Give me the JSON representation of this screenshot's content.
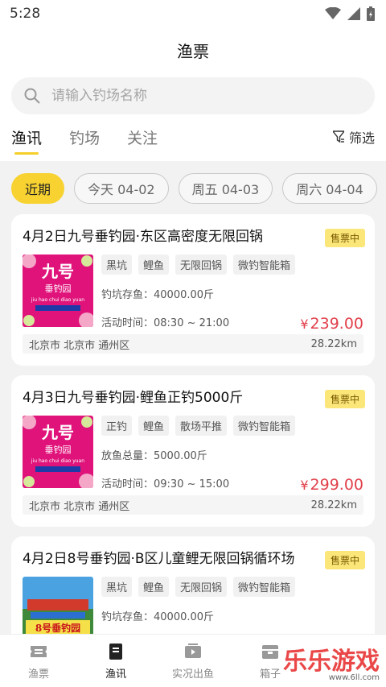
{
  "status": {
    "time": "5:28"
  },
  "header": {
    "title": "渔票"
  },
  "search": {
    "placeholder": "请输入钓场名称"
  },
  "tabs": [
    {
      "label": "渔讯"
    },
    {
      "label": "钓场"
    },
    {
      "label": "关注"
    }
  ],
  "filter": {
    "label": "筛选"
  },
  "dates": [
    {
      "label": "近期"
    },
    {
      "label": "今天 04-02"
    },
    {
      "label": "周五 04-03"
    },
    {
      "label": "周六 04-04"
    }
  ],
  "cards": [
    {
      "title": "4月2日九号垂钓园·东区高密度无限回锅",
      "badge": "售票中",
      "tags": [
        "黑坑",
        "鲤鱼",
        "无限回锅",
        "微钓智能箱"
      ],
      "stock": "钓坑存鱼：40000.00斤",
      "time": "活动时间：08:30 ~ 21:00",
      "currency": "¥",
      "price": "239.00",
      "location": "北京市 北京市 通州区",
      "distance": "28.22km",
      "thumb_title": "九号",
      "thumb_sub": "垂钓园",
      "thumb_pinyin": "jiu hao chui diao yuan"
    },
    {
      "title": "4月3日九号垂钓园·鲤鱼正钓5000斤",
      "badge": "售票中",
      "tags": [
        "正钓",
        "鲤鱼",
        "散场平推",
        "微钓智能箱"
      ],
      "stock": "放鱼总量：5000.00斤",
      "time": "活动时间：09:30 ~ 15:00",
      "currency": "¥",
      "price": "299.00",
      "location": "北京市 北京市 通州区",
      "distance": "28.22km",
      "thumb_title": "九号",
      "thumb_sub": "垂钓园",
      "thumb_pinyin": "jiu hao chui diao yuan"
    },
    {
      "title": "4月2日8号垂钓园·B区儿童鲤无限回锅循环场",
      "badge": "售票中",
      "tags": [
        "黑坑",
        "鲤鱼",
        "无限回锅",
        "微钓智能箱"
      ],
      "stock": "钓坑存鱼：40000.00斤",
      "thumb_title": "8号垂钓园"
    }
  ],
  "nav": [
    {
      "label": "渔票",
      "icon": "ticket-icon"
    },
    {
      "label": "渔讯",
      "icon": "news-icon"
    },
    {
      "label": "实况出鱼",
      "icon": "video-icon"
    },
    {
      "label": "箱子",
      "icon": "box-icon"
    }
  ],
  "watermark": {
    "text": "乐乐游戏",
    "url": "www.6ll.com"
  },
  "colors": {
    "accent": "#f7d230",
    "price": "#e1404b",
    "badge": "#fbe67a"
  }
}
